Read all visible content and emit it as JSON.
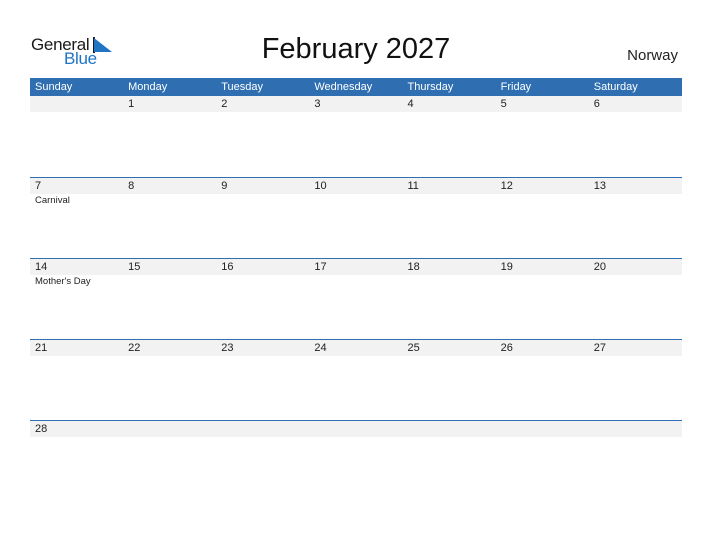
{
  "logo": {
    "part1": "General",
    "part2": "Blue"
  },
  "title": "February 2027",
  "country": "Norway",
  "colors": {
    "accent": "#2f6fb1",
    "row_bg": "#f2f2f2",
    "logo_blue": "#1f74c4"
  },
  "weekdays": [
    "Sunday",
    "Monday",
    "Tuesday",
    "Wednesday",
    "Thursday",
    "Friday",
    "Saturday"
  ],
  "weeks": [
    {
      "days": [
        "",
        "1",
        "2",
        "3",
        "4",
        "5",
        "6"
      ],
      "events": [
        "",
        "",
        "",
        "",
        "",
        "",
        ""
      ]
    },
    {
      "days": [
        "7",
        "8",
        "9",
        "10",
        "11",
        "12",
        "13"
      ],
      "events": [
        "Carnival",
        "",
        "",
        "",
        "",
        "",
        ""
      ]
    },
    {
      "days": [
        "14",
        "15",
        "16",
        "17",
        "18",
        "19",
        "20"
      ],
      "events": [
        "Mother's Day",
        "",
        "",
        "",
        "",
        "",
        ""
      ]
    },
    {
      "days": [
        "21",
        "22",
        "23",
        "24",
        "25",
        "26",
        "27"
      ],
      "events": [
        "",
        "",
        "",
        "",
        "",
        "",
        ""
      ]
    },
    {
      "days": [
        "28",
        "",
        "",
        "",
        "",
        "",
        ""
      ],
      "events": [
        "",
        "",
        "",
        "",
        "",
        "",
        ""
      ]
    }
  ]
}
